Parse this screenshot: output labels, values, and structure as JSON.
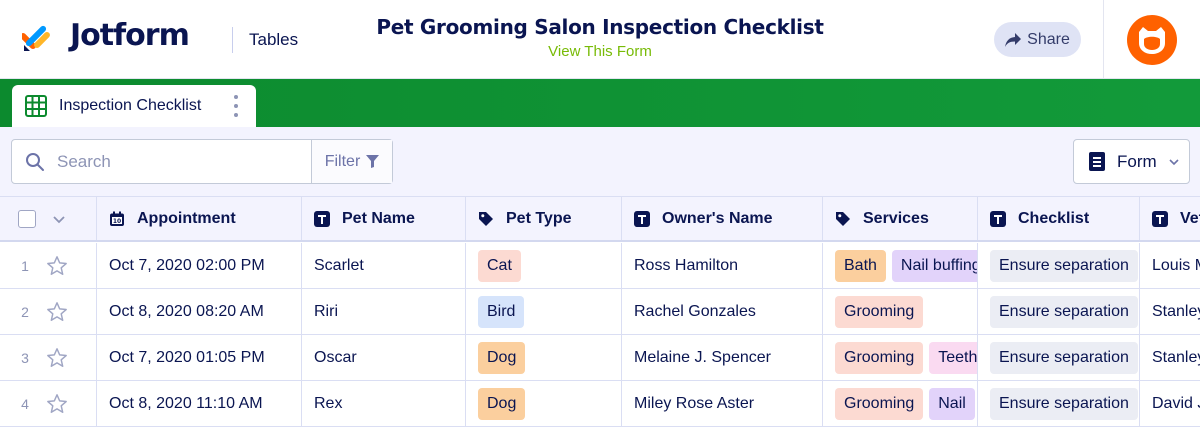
{
  "header": {
    "brand": "Jotform",
    "tables_link": "Tables",
    "form_title": "Pet Grooming Salon Inspection Checklist",
    "view_form": "View This Form",
    "share_label": "Share",
    "accent": "#78bb07"
  },
  "tabs": [
    {
      "label": "Inspection Checklist",
      "icon": "grid-table-icon",
      "active": true
    }
  ],
  "tabstrip_color": "#0c8a2e",
  "toolbar": {
    "search_placeholder": "Search",
    "filter_label": "Filter",
    "view_label": "Form"
  },
  "table": {
    "columns": [
      {
        "label": "Appointment",
        "icon": "calendar-icon"
      },
      {
        "label": "Pet Name",
        "icon": "text-icon"
      },
      {
        "label": "Pet Type",
        "icon": "tag-icon"
      },
      {
        "label": "Owner's Name",
        "icon": "text-icon"
      },
      {
        "label": "Services",
        "icon": "tag-icon"
      },
      {
        "label": "Checklist",
        "icon": "text-icon"
      },
      {
        "label": "Vet",
        "icon": "text-icon"
      }
    ],
    "rows": [
      {
        "num": "1",
        "appointment": "Oct 7, 2020 02:00 PM",
        "pet_name": "Scarlet",
        "pet_type": "Cat",
        "owner": "Ross Hamilton",
        "services": [
          "Bath",
          "Nail buffing"
        ],
        "checklist": "Ensure separation",
        "vet": "Louis M"
      },
      {
        "num": "2",
        "appointment": "Oct 8, 2020 08:20 AM",
        "pet_name": "Riri",
        "pet_type": "Bird",
        "owner": "Rachel Gonzales",
        "services": [
          "Grooming"
        ],
        "checklist": "Ensure separation",
        "vet": "Stanley"
      },
      {
        "num": "3",
        "appointment": "Oct 7, 2020 01:05 PM",
        "pet_name": "Oscar",
        "pet_type": "Dog",
        "owner": "Melaine J. Spencer",
        "services": [
          "Grooming",
          "Teeth"
        ],
        "checklist": "Ensure separation",
        "vet": "Stanley"
      },
      {
        "num": "4",
        "appointment": "Oct 8, 2020 11:10 AM",
        "pet_name": "Rex",
        "pet_type": "Dog",
        "owner": "Miley Rose Aster",
        "services": [
          "Grooming",
          "Nail"
        ],
        "checklist": "Ensure separation",
        "vet": "David J"
      }
    ]
  }
}
